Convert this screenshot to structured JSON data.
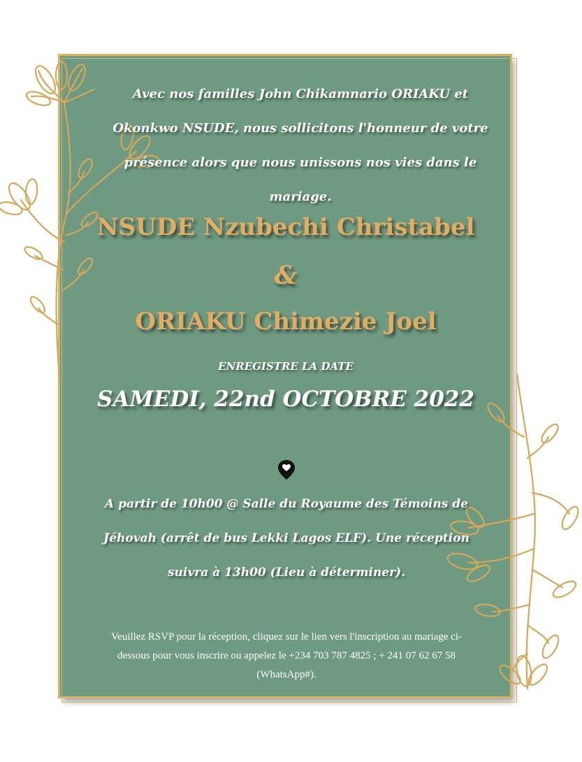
{
  "invitation": {
    "intro": "Avec nos familles John Chikamnario ORIAKU et Okonkwo NSUDE, nous sollicitons l'honneur de votre présence alors que nous unissons nos vies dans le mariage.",
    "bride": "NSUDE Nzubechi Christabel",
    "ampersand": "&",
    "groom": "ORIAKU Chimezie Joel",
    "save_date_label": "ENREGISTRE LA DATE",
    "date": "SAMEDI, 22nd OCTOBRE 2022",
    "venue": "A partir de 10h00 @ Salle du Royaume des Témoins de Jéhovah (arrêt de bus Lekki Lagos ELF). Une réception suivra à 13h00  (Lieu à déterminer).",
    "rsvp": "Veuillez RSVP pour la réception, cliquez sur le lien vers l'inscription au mariage ci-dessous pour vous inscrire ou appelez le +234 703 787 4825 ; + 241 07 62 67 58 (WhatsApp#).",
    "icon": "location-heart-pin-icon"
  },
  "colors": {
    "card": "#6f9a82",
    "gold": "#e2ad62",
    "frame": "#d7b46a",
    "text": "#ffffff"
  }
}
